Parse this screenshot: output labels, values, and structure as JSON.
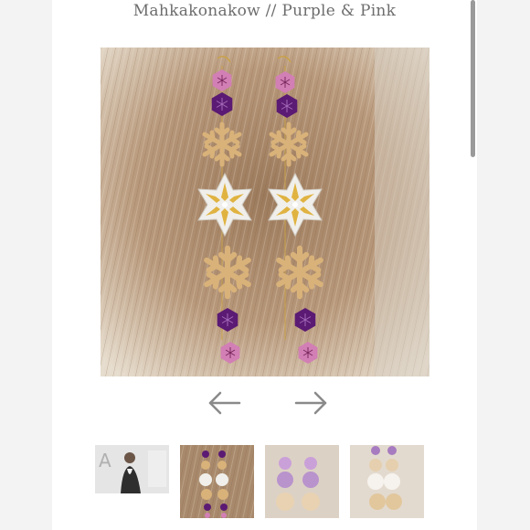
{
  "header": {
    "title": "Mahkakonakow // Purple & Pink"
  },
  "gallery": {
    "main_image_alt": "Mahkakonakow // Purple & Pink",
    "prev_icon": "arrow-left-icon",
    "next_icon": "arrow-right-icon",
    "thumbnails": [
      {
        "alt": "Mahkakonakow // Purple & Pink"
      },
      {
        "alt": "Mahkakonakow // Purple & Pink"
      },
      {
        "alt": "Mahkakonakow // Purple & Pink"
      },
      {
        "alt": "Mahkakonakow // Purple & Pink"
      }
    ]
  },
  "colors": {
    "fur_base": "#b8987a",
    "pink": "#d27fb5",
    "purple": "#5b1a73",
    "gold": "#d9b27a",
    "white_bead": "#f0efeb",
    "arrow": "#8a8a8a"
  }
}
